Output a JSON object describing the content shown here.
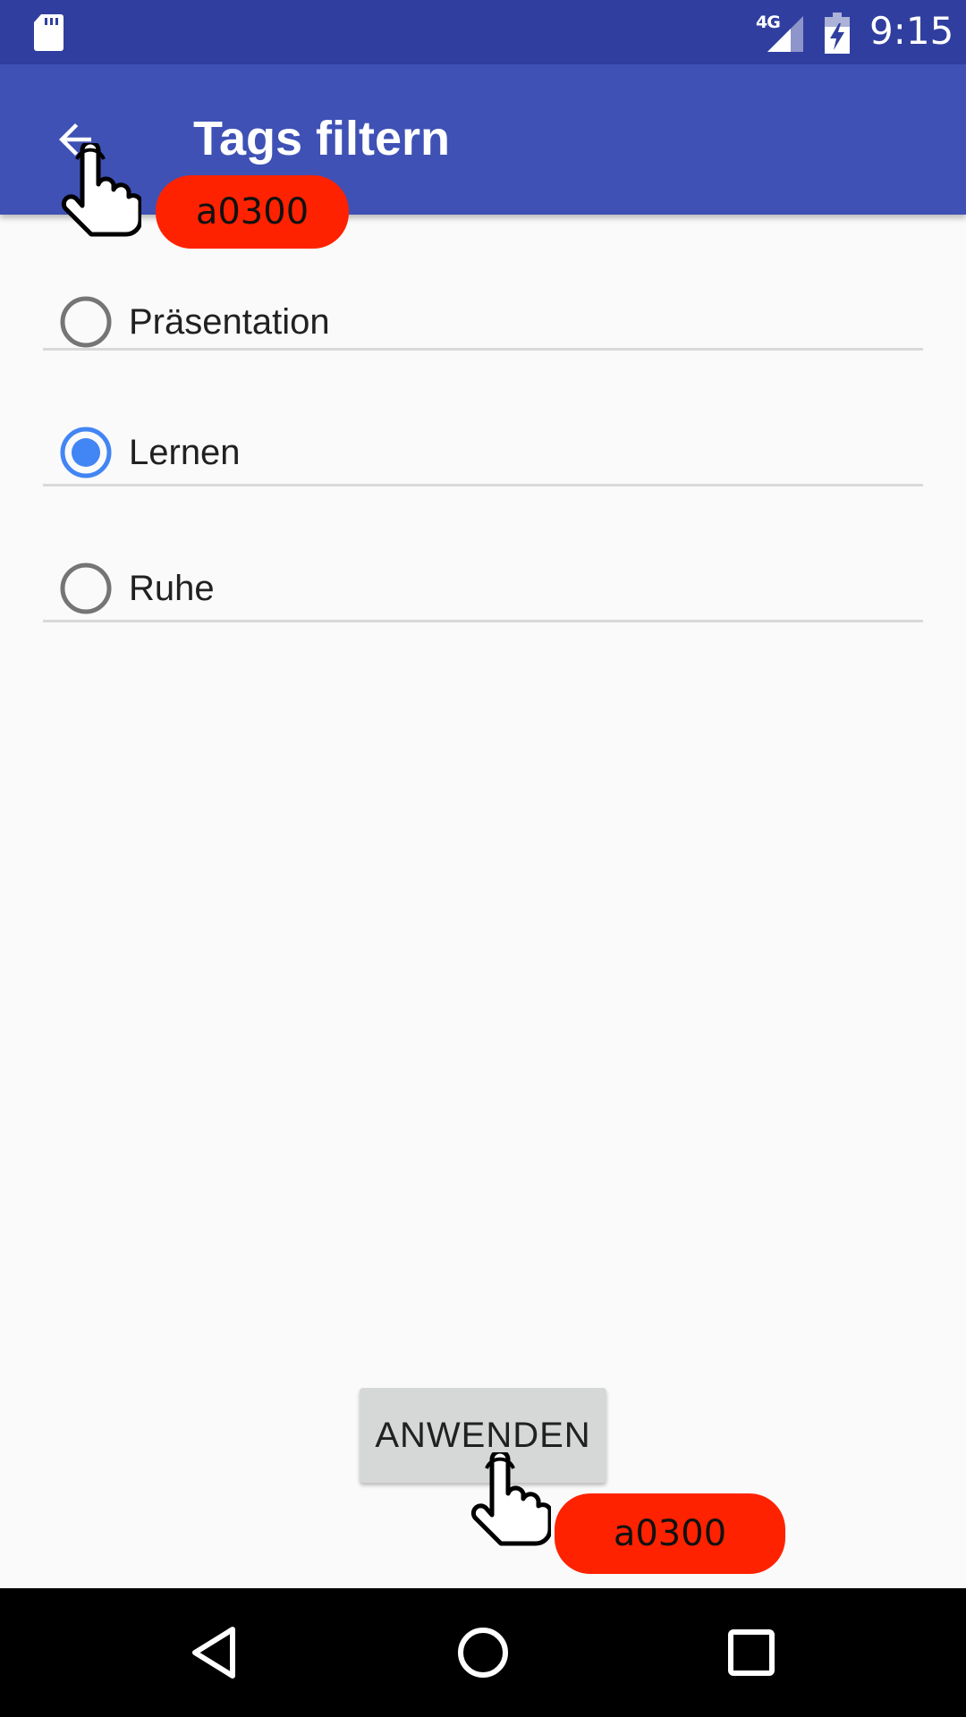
{
  "status_bar": {
    "time": "9:15",
    "network_label": "4G",
    "icons": [
      "sd-card-icon",
      "signal-icon",
      "battery-charging-icon"
    ]
  },
  "app_bar": {
    "title": "Tags filtern",
    "back_icon": "arrow-back-icon"
  },
  "options": [
    {
      "label": "Präsentation",
      "selected": false
    },
    {
      "label": "Lernen",
      "selected": true
    },
    {
      "label": "Ruhe",
      "selected": false
    }
  ],
  "apply_button": {
    "label": "ANWENDEN"
  },
  "annotations": [
    {
      "label": "a0300",
      "icon": "tap-hand-icon"
    },
    {
      "label": "a0300",
      "icon": "tap-hand-icon"
    }
  ],
  "nav_bar": {
    "icons": [
      "back-triangle-icon",
      "home-circle-icon",
      "recents-square-icon"
    ]
  },
  "colors": {
    "status_bar": "#303F9F",
    "app_bar": "#3F51B5",
    "radio_selected": "#4285F4",
    "radio_unselected": "#757575",
    "badge": "#FF2200"
  }
}
